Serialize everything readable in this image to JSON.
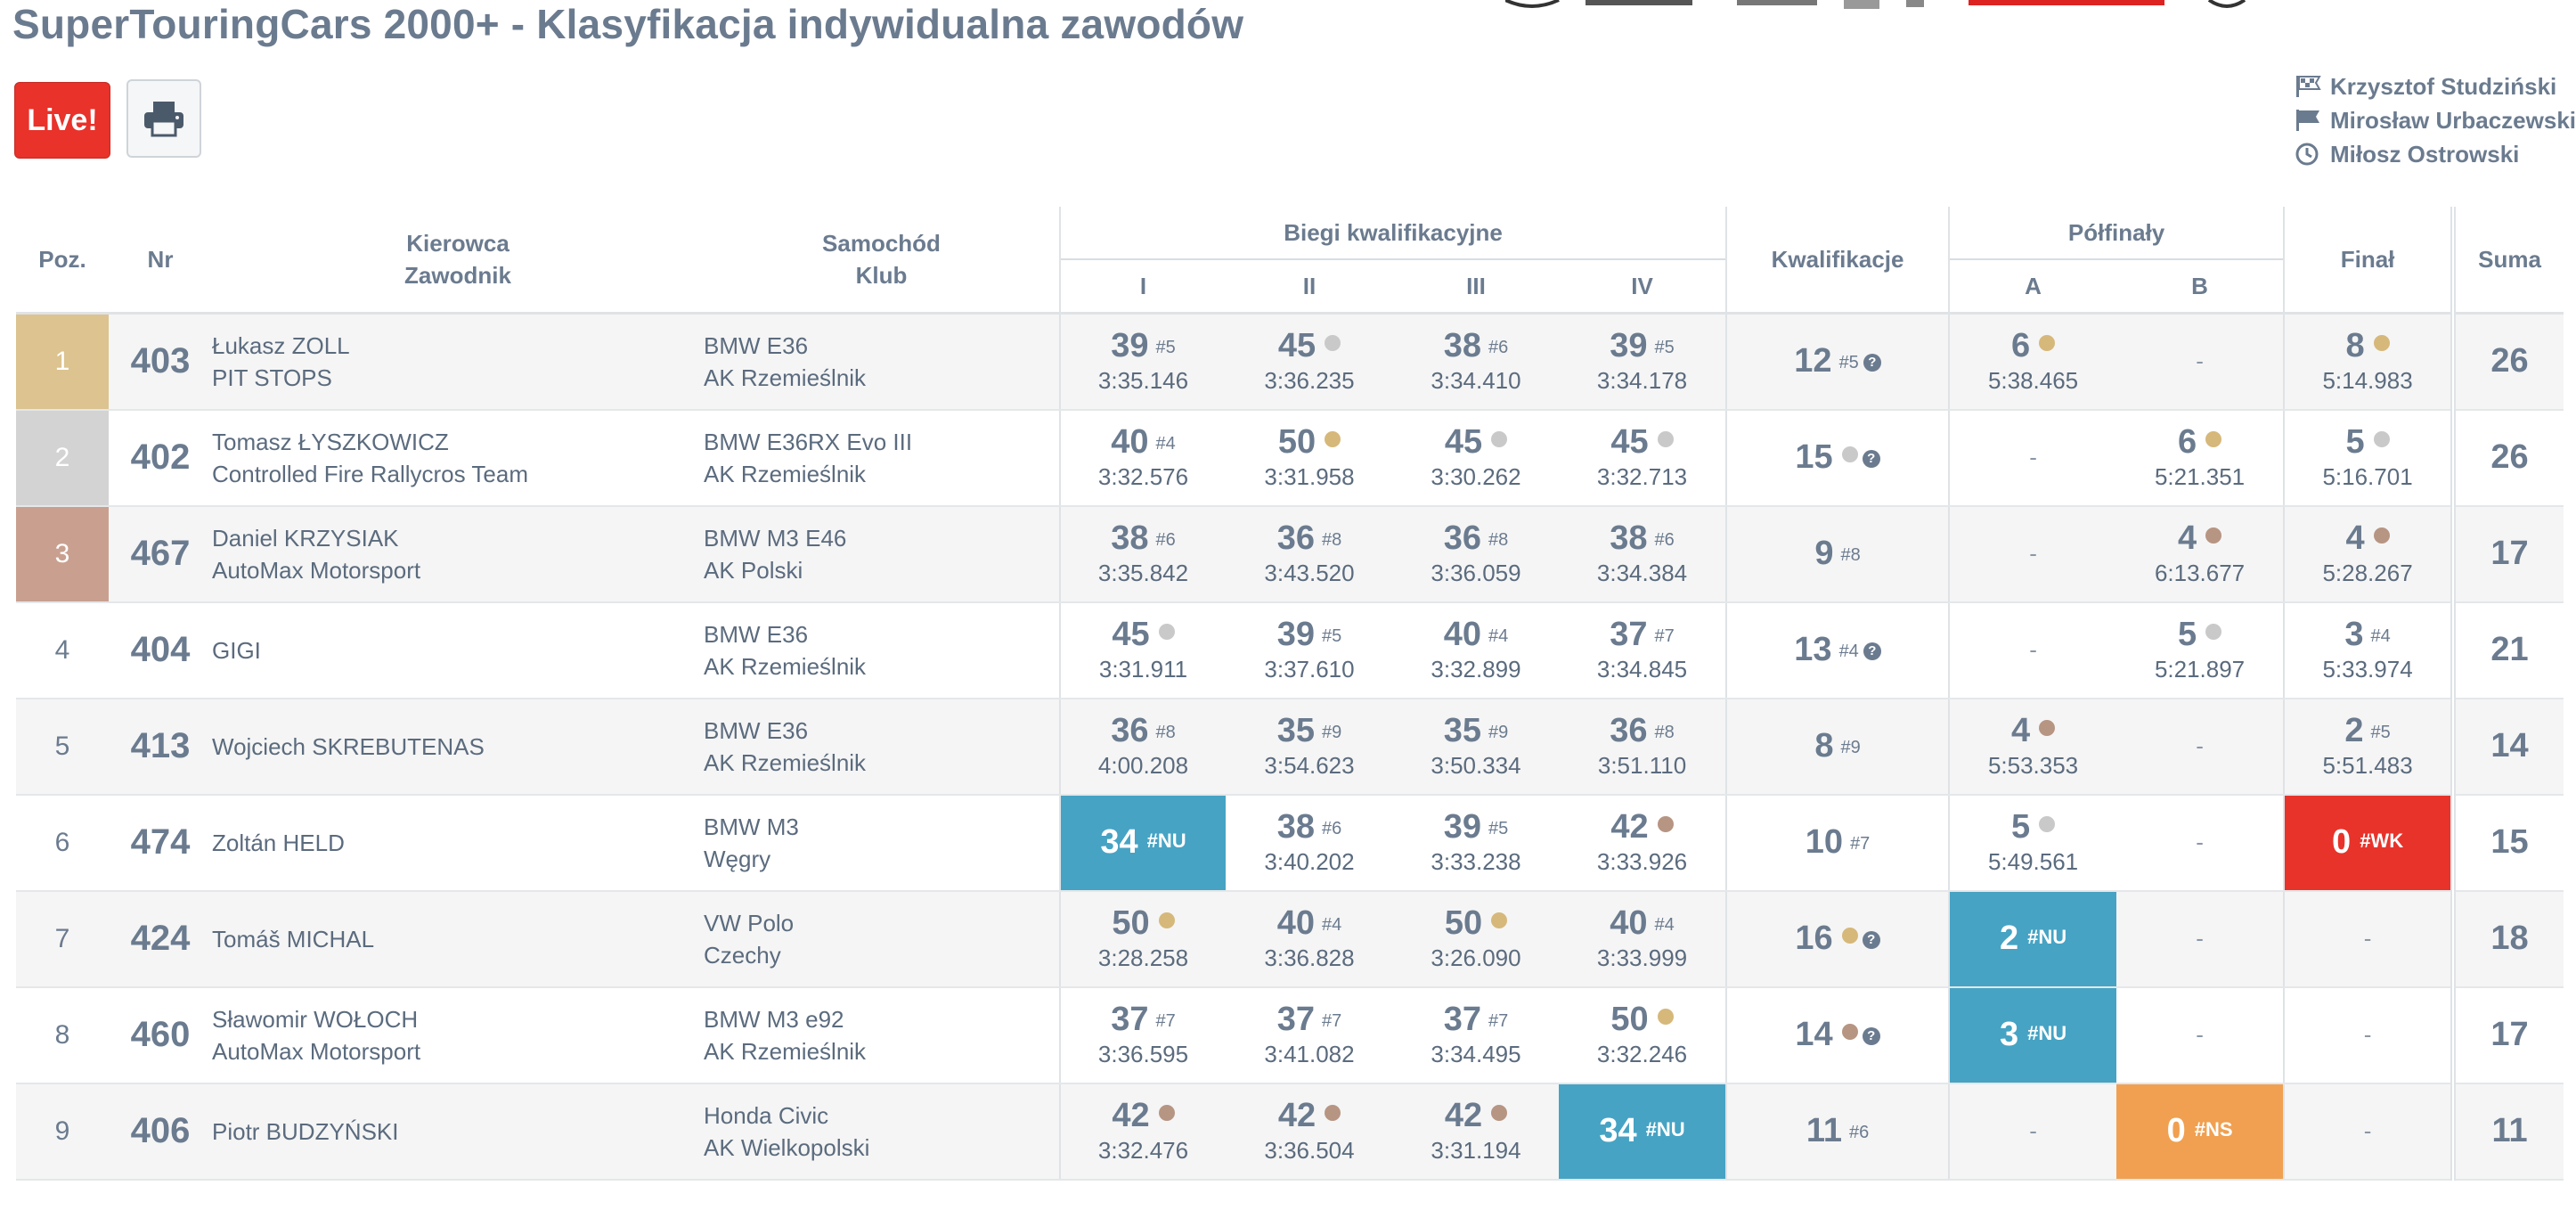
{
  "page": {
    "title": "SuperTouringCars 2000+ - Klasyfikacja indywidualna zawodów"
  },
  "toolbar": {
    "live_label": "Live!",
    "print_icon": "printer-icon"
  },
  "officials": [
    {
      "icon": "checkered-flag-icon",
      "name": "Krzysztof Studziński"
    },
    {
      "icon": "flag-icon",
      "name": "Mirosław Urbaczewski"
    },
    {
      "icon": "clock-icon",
      "name": "Miłosz Ostrowski"
    }
  ],
  "headers": {
    "pos": "Poz.",
    "nr": "Nr",
    "driver1": "Kierowca",
    "driver2": "Zawodnik",
    "car1": "Samochód",
    "car2": "Klub",
    "heats": "Biegi kwalifikacyjne",
    "heat_labels": [
      "I",
      "II",
      "III",
      "IV"
    ],
    "qual": "Kwalifikacje",
    "semis": "Półfinały",
    "semi_labels": [
      "A",
      "B"
    ],
    "final": "Finał",
    "sum": "Suma"
  },
  "colors": {
    "gold": "#dcc38f",
    "silver": "#d3d3d3",
    "bronze": "#c9a08f",
    "nu": "#46a3c4",
    "wk": "#e8332a",
    "ns": "#f0a050"
  },
  "rows": [
    {
      "pos": "1",
      "nr": "403",
      "driver": "Łukasz ZOLL",
      "team": "PIT STOPS",
      "car": "BMW E36",
      "club": "AK Rzemieślnik",
      "heats": [
        {
          "pts": "39",
          "rank": "#5",
          "time": "3:35.146"
        },
        {
          "pts": "45",
          "medal": "silver",
          "time": "3:36.235"
        },
        {
          "pts": "38",
          "rank": "#6",
          "time": "3:34.410"
        },
        {
          "pts": "39",
          "rank": "#5",
          "time": "3:34.178"
        }
      ],
      "qual": {
        "pts": "12",
        "rank": "#5",
        "q": true
      },
      "semis": [
        {
          "pts": "6",
          "medal": "gold",
          "time": "5:38.465"
        },
        {
          "dash": "-"
        }
      ],
      "final": {
        "pts": "8",
        "medal": "gold",
        "time": "5:14.983"
      },
      "sum": "26"
    },
    {
      "pos": "2",
      "nr": "402",
      "driver": "Tomasz ŁYSZKOWICZ",
      "team": "Controlled Fire Rallycros Team",
      "car": "BMW E36RX Evo III",
      "club": "AK Rzemieślnik",
      "heats": [
        {
          "pts": "40",
          "rank": "#4",
          "time": "3:32.576"
        },
        {
          "pts": "50",
          "medal": "gold",
          "time": "3:31.958"
        },
        {
          "pts": "45",
          "medal": "silver",
          "time": "3:30.262"
        },
        {
          "pts": "45",
          "medal": "silver",
          "time": "3:32.713"
        }
      ],
      "qual": {
        "pts": "15",
        "medal": "silver",
        "q": true
      },
      "semis": [
        {
          "dash": "-"
        },
        {
          "pts": "6",
          "medal": "gold",
          "time": "5:21.351"
        }
      ],
      "final": {
        "pts": "5",
        "medal": "silver",
        "time": "5:16.701"
      },
      "sum": "26"
    },
    {
      "pos": "3",
      "nr": "467",
      "driver": "Daniel KRZYSIAK",
      "team": "AutoMax Motorsport",
      "car": "BMW M3 E46",
      "club": "AK Polski",
      "heats": [
        {
          "pts": "38",
          "rank": "#6",
          "time": "3:35.842"
        },
        {
          "pts": "36",
          "rank": "#8",
          "time": "3:43.520"
        },
        {
          "pts": "36",
          "rank": "#8",
          "time": "3:36.059"
        },
        {
          "pts": "38",
          "rank": "#6",
          "time": "3:34.384"
        }
      ],
      "qual": {
        "pts": "9",
        "rank": "#8"
      },
      "semis": [
        {
          "dash": "-"
        },
        {
          "pts": "4",
          "medal": "bronze",
          "time": "6:13.677"
        }
      ],
      "final": {
        "pts": "4",
        "medal": "bronze",
        "time": "5:28.267"
      },
      "sum": "17"
    },
    {
      "pos": "4",
      "nr": "404",
      "driver": "GIGI",
      "team": "",
      "car": "BMW E36",
      "club": "AK Rzemieślnik",
      "heats": [
        {
          "pts": "45",
          "medal": "silver",
          "time": "3:31.911"
        },
        {
          "pts": "39",
          "rank": "#5",
          "time": "3:37.610"
        },
        {
          "pts": "40",
          "rank": "#4",
          "time": "3:32.899"
        },
        {
          "pts": "37",
          "rank": "#7",
          "time": "3:34.845"
        }
      ],
      "qual": {
        "pts": "13",
        "rank": "#4",
        "q": true
      },
      "semis": [
        {
          "dash": "-"
        },
        {
          "pts": "5",
          "medal": "silver",
          "time": "5:21.897"
        }
      ],
      "final": {
        "pts": "3",
        "rank": "#4",
        "time": "5:33.974"
      },
      "sum": "21"
    },
    {
      "pos": "5",
      "nr": "413",
      "driver": "Wojciech SKREBUTENAS",
      "team": "",
      "car": "BMW E36",
      "club": "AK Rzemieślnik",
      "heats": [
        {
          "pts": "36",
          "rank": "#8",
          "time": "4:00.208"
        },
        {
          "pts": "35",
          "rank": "#9",
          "time": "3:54.623"
        },
        {
          "pts": "35",
          "rank": "#9",
          "time": "3:50.334"
        },
        {
          "pts": "36",
          "rank": "#8",
          "time": "3:51.110"
        }
      ],
      "qual": {
        "pts": "8",
        "rank": "#9"
      },
      "semis": [
        {
          "pts": "4",
          "medal": "bronze",
          "time": "5:53.353"
        },
        {
          "dash": "-"
        }
      ],
      "final": {
        "pts": "2",
        "rank": "#5",
        "time": "5:51.483"
      },
      "sum": "14"
    },
    {
      "pos": "6",
      "nr": "474",
      "driver": "Zoltán HELD",
      "team": "",
      "car": "BMW M3",
      "club": "Węgry",
      "heats": [
        {
          "pts": "34",
          "code": "#NU",
          "status": "nu"
        },
        {
          "pts": "38",
          "rank": "#6",
          "time": "3:40.202"
        },
        {
          "pts": "39",
          "rank": "#5",
          "time": "3:33.238"
        },
        {
          "pts": "42",
          "medal": "bronze",
          "time": "3:33.926"
        }
      ],
      "qual": {
        "pts": "10",
        "rank": "#7"
      },
      "semis": [
        {
          "pts": "5",
          "medal": "silver",
          "time": "5:49.561"
        },
        {
          "dash": "-"
        }
      ],
      "final": {
        "pts": "0",
        "code": "#WK",
        "status": "wk"
      },
      "sum": "15"
    },
    {
      "pos": "7",
      "nr": "424",
      "driver": "Tomáš MICHAL",
      "team": "",
      "car": "VW Polo",
      "club": "Czechy",
      "heats": [
        {
          "pts": "50",
          "medal": "gold",
          "time": "3:28.258"
        },
        {
          "pts": "40",
          "rank": "#4",
          "time": "3:36.828"
        },
        {
          "pts": "50",
          "medal": "gold",
          "time": "3:26.090"
        },
        {
          "pts": "40",
          "rank": "#4",
          "time": "3:33.999"
        }
      ],
      "qual": {
        "pts": "16",
        "medal": "gold",
        "q": true
      },
      "semis": [
        {
          "pts": "2",
          "code": "#NU",
          "status": "nu"
        },
        {
          "dash": "-"
        }
      ],
      "final": {
        "dash": "-"
      },
      "sum": "18"
    },
    {
      "pos": "8",
      "nr": "460",
      "driver": "Sławomir WOŁOCH",
      "team": "AutoMax Motorsport",
      "car": "BMW M3 e92",
      "club": "AK Rzemieślnik",
      "heats": [
        {
          "pts": "37",
          "rank": "#7",
          "time": "3:36.595"
        },
        {
          "pts": "37",
          "rank": "#7",
          "time": "3:41.082"
        },
        {
          "pts": "37",
          "rank": "#7",
          "time": "3:34.495"
        },
        {
          "pts": "50",
          "medal": "gold",
          "time": "3:32.246"
        }
      ],
      "qual": {
        "pts": "14",
        "medal": "bronze",
        "q": true
      },
      "semis": [
        {
          "pts": "3",
          "code": "#NU",
          "status": "nu"
        },
        {
          "dash": "-"
        }
      ],
      "final": {
        "dash": "-"
      },
      "sum": "17"
    },
    {
      "pos": "9",
      "nr": "406",
      "driver": "Piotr BUDZYŃSKI",
      "team": "",
      "car": "Honda Civic",
      "club": "AK Wielkopolski",
      "heats": [
        {
          "pts": "42",
          "medal": "bronze",
          "time": "3:32.476"
        },
        {
          "pts": "42",
          "medal": "bronze",
          "time": "3:36.504"
        },
        {
          "pts": "42",
          "medal": "bronze",
          "time": "3:31.194"
        },
        {
          "pts": "34",
          "code": "#NU",
          "status": "nu"
        }
      ],
      "qual": {
        "pts": "11",
        "rank": "#6"
      },
      "semis": [
        {
          "dash": "-"
        },
        {
          "pts": "0",
          "code": "#NS",
          "status": "ns"
        }
      ],
      "final": {
        "dash": "-"
      },
      "sum": "11"
    }
  ]
}
